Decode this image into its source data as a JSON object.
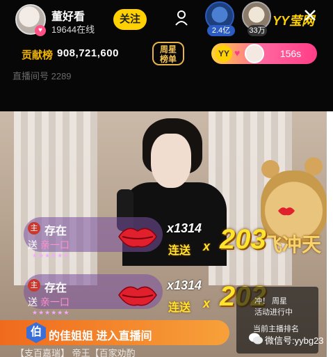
{
  "header": {
    "streamer_name": "董好看",
    "online_count": "19644在线",
    "follow_label": "关注",
    "fans": [
      {
        "count": "2.4亿"
      },
      {
        "count": "33万"
      }
    ],
    "yy_logo": "YY莹网",
    "contribution_label": "贡献榜",
    "contribution_value": "908,721,600",
    "weekly_star_label": "周星",
    "weekly_star_sub": "榜单",
    "pk_logo": "YY",
    "pk_timer": "156s",
    "room_id": "直播间号 2289"
  },
  "gifts": [
    {
      "master": "主",
      "name": "存在",
      "give_prefix": "送",
      "give_item": "亲一口",
      "stars": "★★★★★★",
      "x_count": "x1314",
      "combo": "连送",
      "mult": "x",
      "number": "203"
    },
    {
      "master": "主",
      "name": "存在",
      "give_prefix": "送",
      "give_item": "亲一口",
      "stars": "★★★★★★",
      "x_count": "x1314",
      "combo": "连送",
      "mult": "x",
      "number": "202"
    }
  ],
  "side_panel": {
    "line1": "冲！ 周星",
    "line2": "活动进行中",
    "line3": "当前主播排名"
  },
  "overlay_title": "一飞冲天",
  "enter": {
    "badge": "伯",
    "text": "的佳姐姐 进入直播间"
  },
  "bottom_text": "【支百嘉瑞】 帝王【百家劝酌",
  "watermark": "微信号:yybg23",
  "colors": {
    "accent_yellow": "#ffd100",
    "pk_pink": "#ff3d87",
    "combo_yellow": "#ffe42e"
  }
}
